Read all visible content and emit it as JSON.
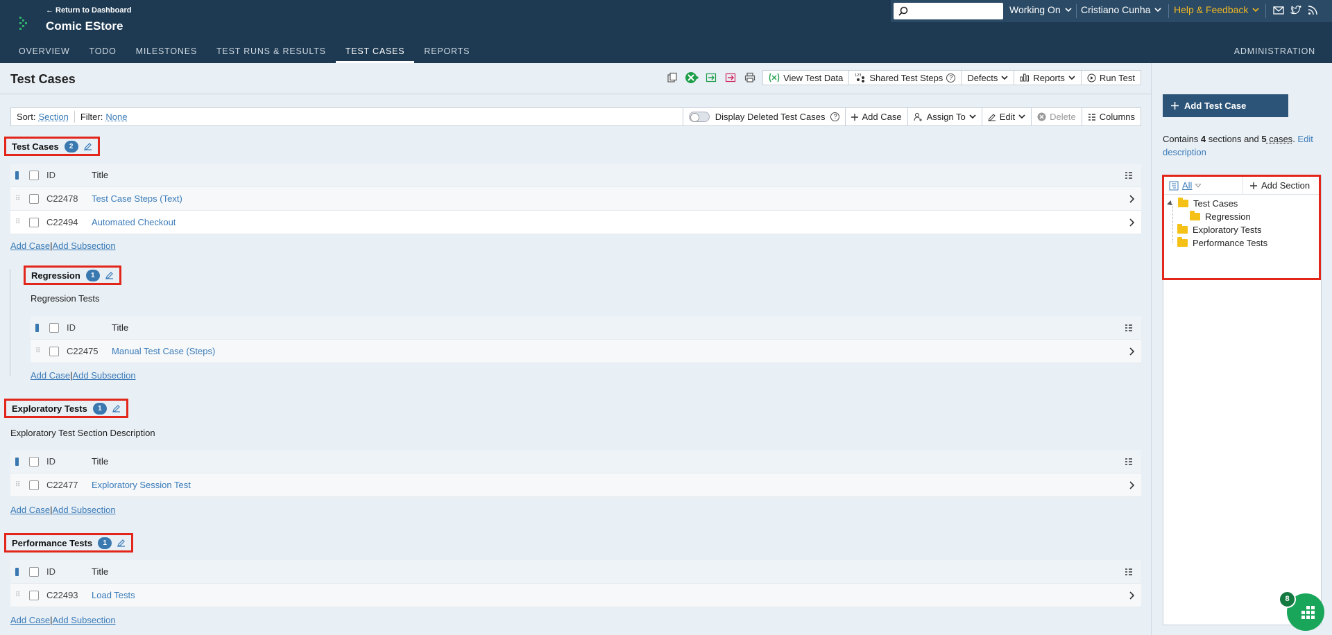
{
  "header": {
    "return_link": "← Return to Dashboard",
    "project_name": "Comic EStore",
    "search_placeholder": "",
    "working_on": "Working On",
    "user": "Cristiano Cunha",
    "help": "Help & Feedback",
    "nav": [
      "OVERVIEW",
      "TODO",
      "MILESTONES",
      "TEST RUNS & RESULTS",
      "TEST CASES",
      "REPORTS"
    ],
    "active_tab": "TEST CASES",
    "admin": "ADMINISTRATION"
  },
  "page": {
    "title": "Test Cases",
    "toolbar": {
      "view_test_data": "View Test Data",
      "shared_steps": "Shared Test Steps",
      "defects": "Defects",
      "reports": "Reports",
      "run_test": "Run Test"
    },
    "filterbar": {
      "sort_label": "Sort:",
      "sort_value": "Section",
      "filter_label": "Filter:",
      "filter_value": "None",
      "display_deleted": "Display Deleted Test Cases",
      "add_case": "Add Case",
      "assign_to": "Assign To",
      "edit": "Edit",
      "delete": "Delete",
      "columns": "Columns"
    }
  },
  "grid_columns": {
    "id": "ID",
    "title": "Title"
  },
  "sections": [
    {
      "name": "Test Cases",
      "count": "2",
      "description": "",
      "cases": [
        {
          "id": "C22478",
          "title": "Test Case Steps (Text)"
        },
        {
          "id": "C22494",
          "title": "Automated Checkout"
        }
      ]
    },
    {
      "name": "Regression",
      "count": "1",
      "description": "Regression Tests",
      "cases": [
        {
          "id": "C22475",
          "title": "Manual Test Case (Steps)"
        }
      ]
    },
    {
      "name": "Exploratory Tests",
      "count": "1",
      "description": "Exploratory Test Section Description",
      "cases": [
        {
          "id": "C22477",
          "title": "Exploratory Session Test"
        }
      ]
    },
    {
      "name": "Performance Tests",
      "count": "1",
      "description": "",
      "cases": [
        {
          "id": "C22493",
          "title": "Load Tests"
        }
      ]
    }
  ],
  "section_links": {
    "add_case": "Add Case",
    "sep": "|",
    "add_subsection": "Add Subsection"
  },
  "sidebar": {
    "add_test_case": "Add Test Case",
    "contains_prefix": "Contains ",
    "sections_count": "4",
    "sections_word": " sections and ",
    "cases_count": "5",
    "cases_word": " cases",
    "contains_suffix": ". ",
    "edit_description": "Edit description",
    "tree_all": "All",
    "tree_add_section": "Add Section",
    "tree": [
      "Test Cases",
      "Regression",
      "Exploratory Tests",
      "Performance Tests"
    ]
  },
  "fab_count": "8",
  "colors": {
    "accent": "#3a7bb8",
    "header": "#1e3a52",
    "highlight": "#e3261b",
    "help": "#f2b824"
  }
}
